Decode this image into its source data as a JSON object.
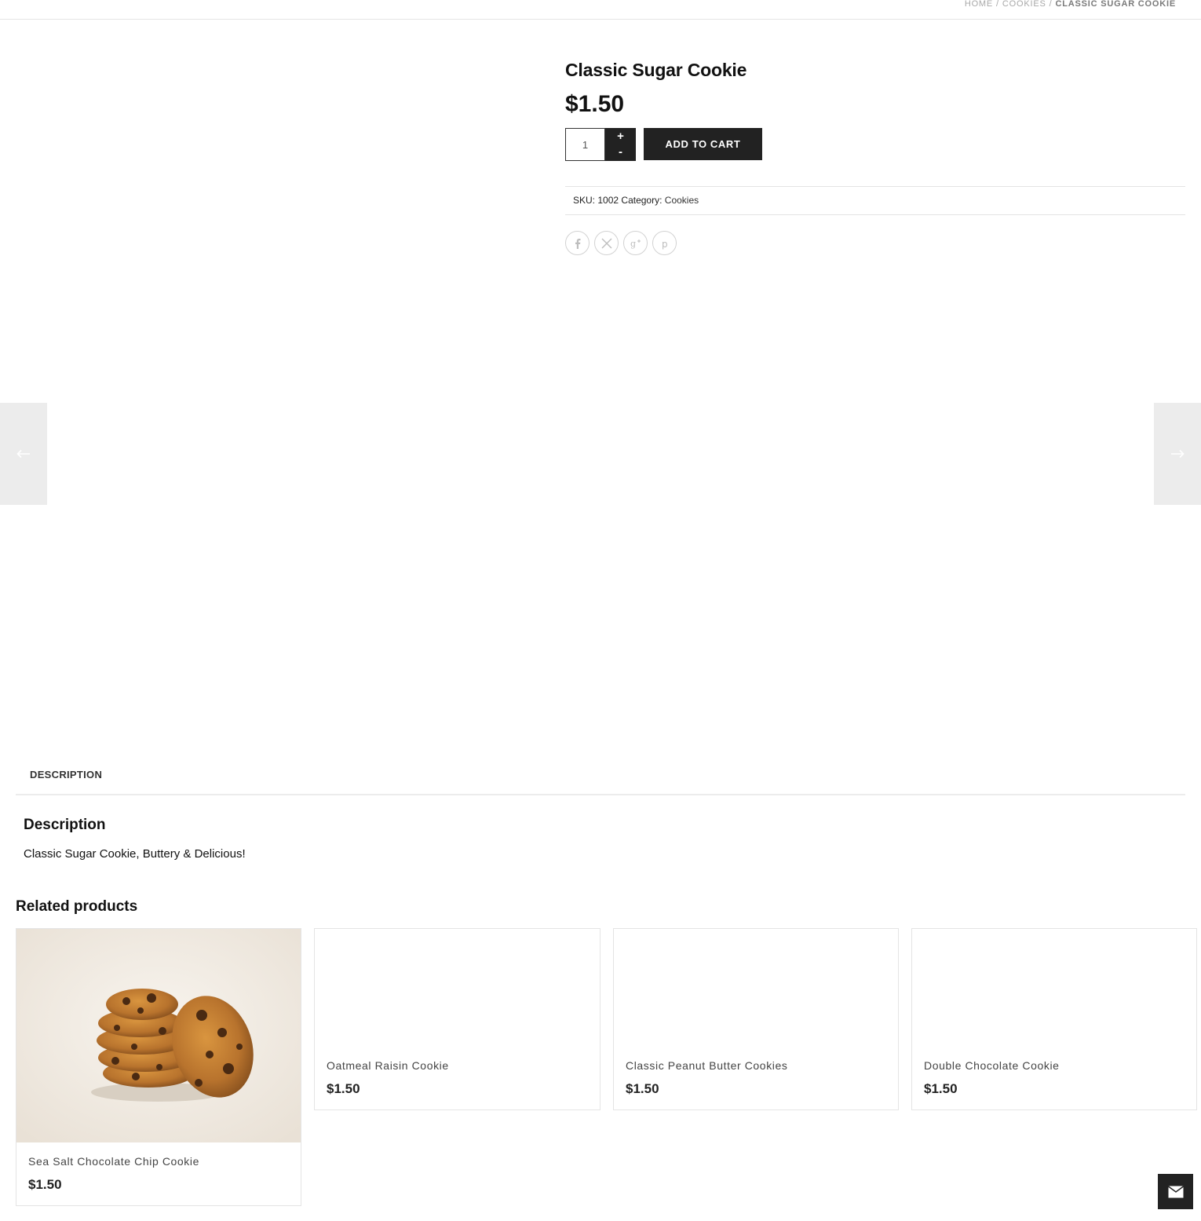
{
  "breadcrumb": {
    "home": "Home",
    "separator": "/",
    "category": "Cookies",
    "current": "Classic Sugar Cookie"
  },
  "product": {
    "title": "Classic Sugar Cookie",
    "price": "$1.50",
    "quantity": "1",
    "qty_plus": "+",
    "qty_minus": "-",
    "add_to_cart": "ADD TO CART",
    "meta": {
      "sku_label": "SKU:",
      "sku": "1002",
      "category_label": "Category:",
      "category": "Cookies"
    },
    "share": [
      {
        "name": "facebook",
        "icon": "facebook-icon"
      },
      {
        "name": "twitter",
        "icon": "x-twitter-icon"
      },
      {
        "name": "google-plus",
        "icon": "google-plus-icon"
      },
      {
        "name": "pinterest",
        "icon": "pinterest-icon"
      }
    ]
  },
  "navigation": {
    "prev_icon": "arrow-left-icon",
    "next_icon": "arrow-right-icon"
  },
  "tabs": {
    "description_tab": "DESCRIPTION"
  },
  "description": {
    "heading": "Description",
    "text": "Classic Sugar Cookie, Buttery & Delicious!"
  },
  "related": {
    "heading": "Related products",
    "items": [
      {
        "title": "Sea Salt Chocolate Chip Cookie",
        "price": "$1.50",
        "has_image": true
      },
      {
        "title": "Oatmeal Raisin Cookie",
        "price": "$1.50",
        "has_image": false
      },
      {
        "title": "Classic Peanut Butter Cookies",
        "price": "$1.50",
        "has_image": false
      },
      {
        "title": "Double Chocolate Cookie",
        "price": "$1.50",
        "has_image": false
      }
    ]
  },
  "contact": {
    "icon": "envelope-icon"
  },
  "colors": {
    "dark": "#222222",
    "border": "#e4e4e4",
    "nav_bg": "#ececec",
    "breadcrumb": "#a8a8a8"
  }
}
